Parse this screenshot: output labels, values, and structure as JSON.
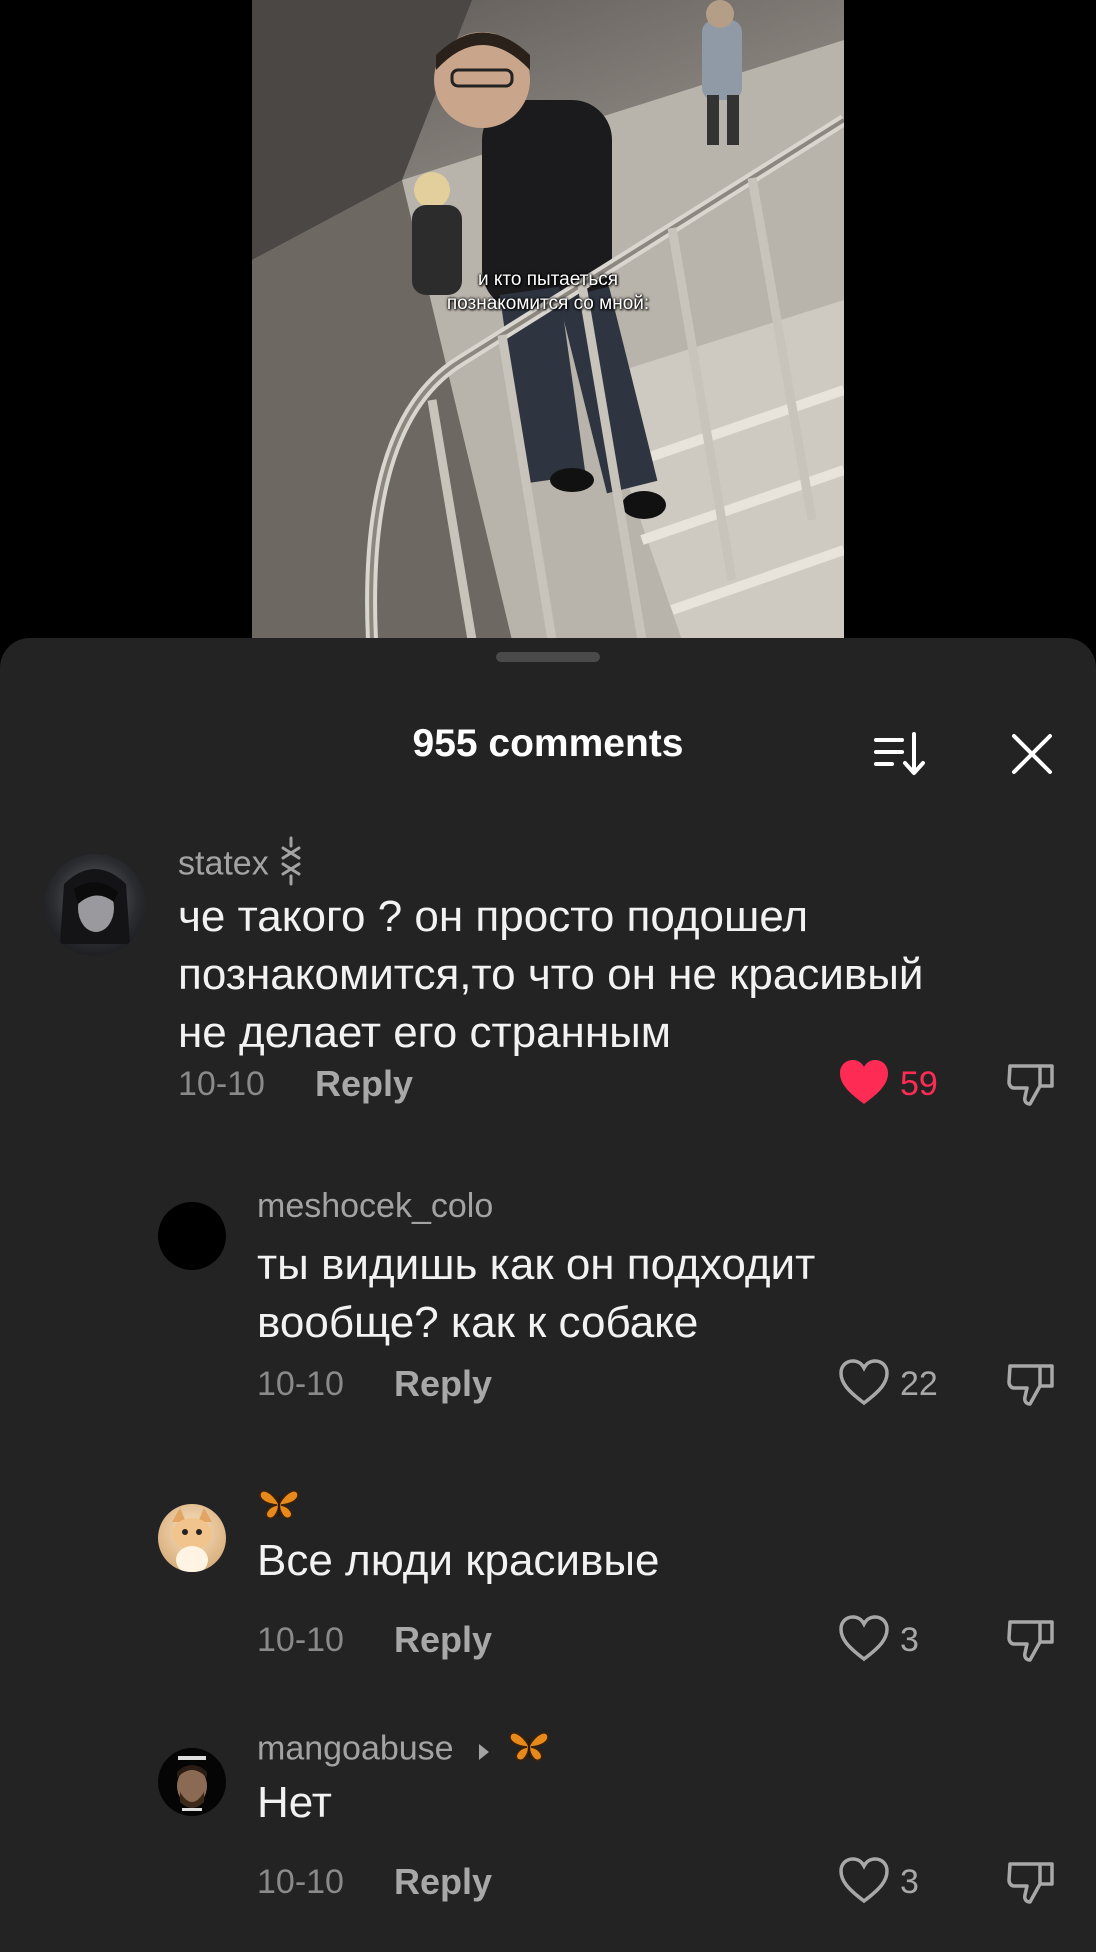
{
  "video": {
    "caption_lines": [
      "и кто пытаеться",
      "познакомится со мной:"
    ]
  },
  "sheet": {
    "title": "955 comments",
    "sort_icon": "sort-icon",
    "close_icon": "close-icon"
  },
  "comments": [
    {
      "username": "statex",
      "badge_icon": "chain-link-icon",
      "text_lines": [
        "че такого ? он просто подошел",
        "познакомится,то что он не красивый",
        "не делает его странным"
      ],
      "date": "10-10",
      "reply_label": "Reply",
      "likes": "59",
      "liked": true
    },
    {
      "username": "meshocek_colo",
      "text_lines": [
        "ты видишь как он подходит",
        "вообще? как к собаке"
      ],
      "date": "10-10",
      "reply_label": "Reply",
      "likes": "22",
      "liked": false
    },
    {
      "username": "",
      "username_icon": "butterfly-icon",
      "text_lines": [
        "Все люди красивые"
      ],
      "date": "10-10",
      "reply_label": "Reply",
      "likes": "3",
      "liked": false
    },
    {
      "username": "mangoabuse",
      "reply_to_icon": "butterfly-icon",
      "text_lines": [
        "Нет"
      ],
      "date": "10-10",
      "reply_label": "Reply",
      "likes": "3",
      "liked": false
    }
  ],
  "colors": {
    "sheet_bg": "#232323",
    "like_active": "#fe2c55",
    "secondary_text": "#a3a3a3"
  }
}
